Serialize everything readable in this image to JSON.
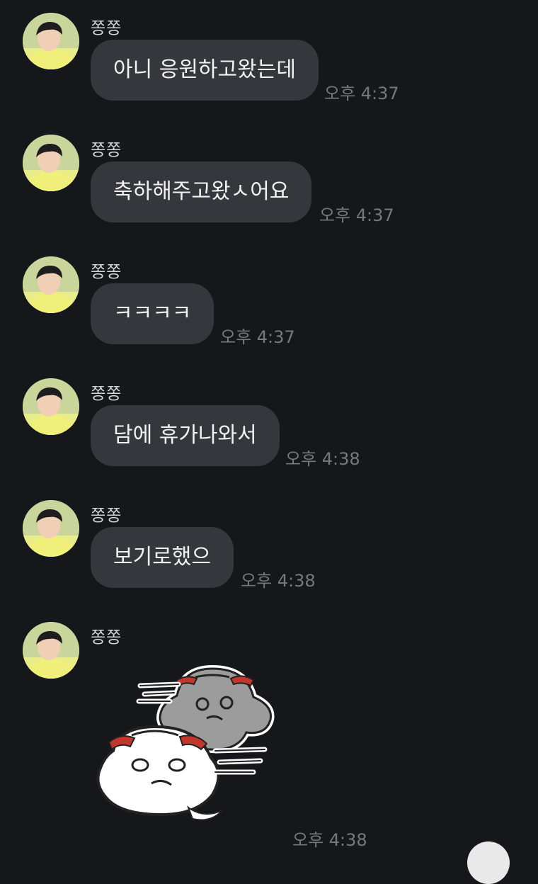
{
  "sender_name": "쫑쫑",
  "messages": [
    {
      "text": "아니 응원하고왔는데",
      "time": "오후 4:37"
    },
    {
      "text": "축하해주고왔ㅅ어요",
      "time": "오후 4:37"
    },
    {
      "text": "ㅋㅋㅋㅋ",
      "time": "오후 4:37"
    },
    {
      "text": "담에 휴가나와서",
      "time": "오후 4:38"
    },
    {
      "text": "보기로했으",
      "time": "오후 4:38"
    }
  ],
  "sticker": {
    "icon": "dumpling-characters-sticker",
    "time": "오후 4:38"
  },
  "colors": {
    "background": "#16171b",
    "bubble": "#36373c",
    "text": "#f2f2f2",
    "time": "#77787d"
  }
}
